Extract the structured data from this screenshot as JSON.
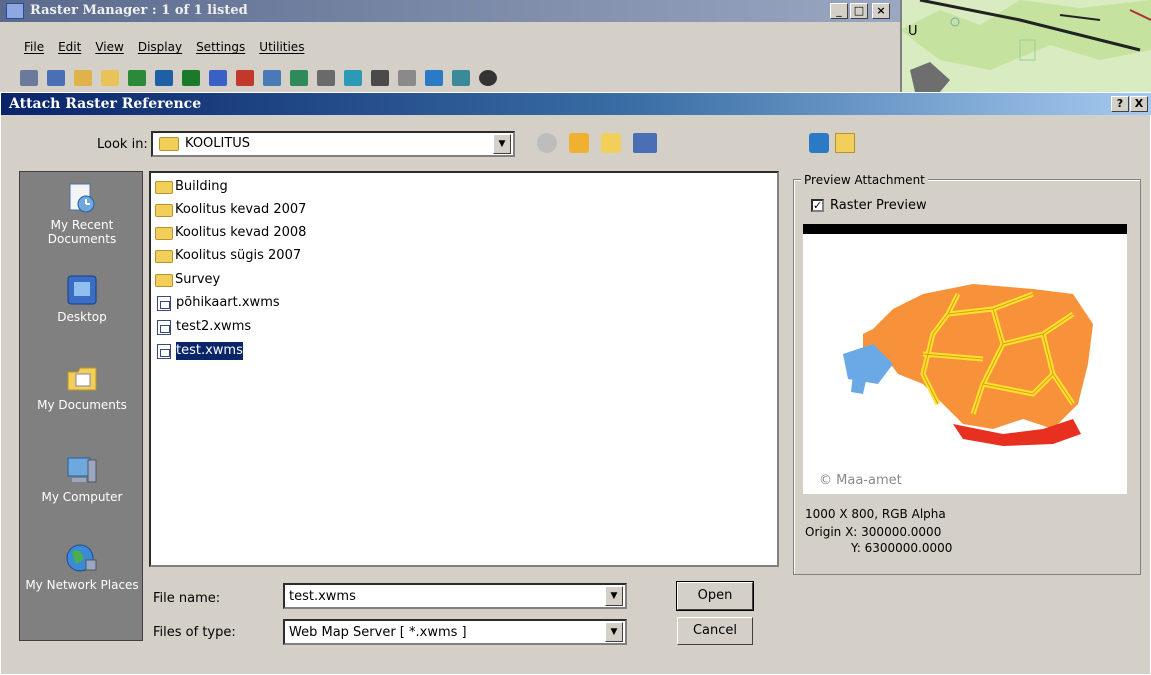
{
  "raster_manager": {
    "title": "Raster Manager : 1 of 1 listed",
    "menu": [
      "File",
      "Edit",
      "View",
      "Display",
      "Settings",
      "Utilities"
    ],
    "bg_map_label": "U"
  },
  "dialog": {
    "title": "Attach Raster Reference",
    "help_label": "?",
    "close_label": "X",
    "look_in_label": "Look in:",
    "look_in_value": "KOOLITUS",
    "places": [
      {
        "label": "My Recent Documents",
        "icon": "recent-documents-icon"
      },
      {
        "label": "Desktop",
        "icon": "desktop-icon"
      },
      {
        "label": "My Documents",
        "icon": "my-documents-icon"
      },
      {
        "label": "My Computer",
        "icon": "my-computer-icon"
      },
      {
        "label": "My Network Places",
        "icon": "network-places-icon"
      }
    ],
    "files": [
      {
        "name": "Building",
        "type": "folder"
      },
      {
        "name": "Koolitus kevad 2007",
        "type": "folder"
      },
      {
        "name": "Koolitus kevad 2008",
        "type": "folder"
      },
      {
        "name": "Koolitus sügis 2007",
        "type": "folder"
      },
      {
        "name": "Survey",
        "type": "folder"
      },
      {
        "name": "põhikaart.xwms",
        "type": "file"
      },
      {
        "name": "test2.xwms",
        "type": "file"
      },
      {
        "name": "test.xwms",
        "type": "file",
        "selected": true
      }
    ],
    "file_name_label": "File name:",
    "file_name_value": "test.xwms",
    "file_type_label": "Files of type:",
    "file_type_value": "Web Map Server [ *.xwms ]",
    "open_label": "Open",
    "cancel_label": "Cancel",
    "preview": {
      "group_label": "Preview Attachment",
      "checkbox_label": "Raster Preview",
      "checked": true,
      "copyright": "© Maa-amet",
      "info_size": "1000 X 800, RGB Alpha",
      "info_origin_x": "Origin  X: 300000.0000",
      "info_origin_y": "Y: 6300000.0000"
    }
  }
}
